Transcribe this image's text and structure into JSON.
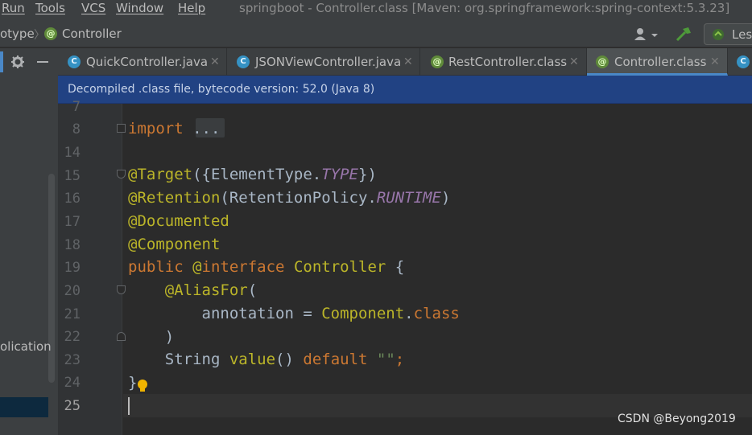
{
  "menubar": {
    "items": [
      "Run",
      "Tools",
      "VCS",
      "Window",
      "Help"
    ],
    "title": "springboot - Controller.class [Maven: org.springframework:spring-context:5.3.23]"
  },
  "navbar": {
    "crumb_prev": "otype",
    "crumb_current": "Controller",
    "run_config": "Les"
  },
  "tabs": [
    {
      "label": "QuickController.java",
      "icon": "class-icon"
    },
    {
      "label": "JSONViewController.java",
      "icon": "class-icon"
    },
    {
      "label": "RestController.class",
      "icon": "annotation-icon"
    },
    {
      "label": "Controller.class",
      "icon": "annotation-icon",
      "active": true
    },
    {
      "label": "",
      "icon": "class-icon"
    }
  ],
  "infobar": {
    "message": "Decompiled .class file, bytecode version: 52.0 (Java 8)"
  },
  "sidebar": {
    "partial_label": "olication"
  },
  "editor": {
    "line_numbers": [
      "7",
      "8",
      "14",
      "15",
      "16",
      "17",
      "18",
      "19",
      "20",
      "21",
      "22",
      "23",
      "24",
      "25"
    ],
    "lines": [
      "",
      "import ...",
      "",
      "@Target({ElementType.TYPE})",
      "@Retention(RetentionPolicy.RUNTIME)",
      "@Documented",
      "@Component",
      "public @interface Controller {",
      "    @AliasFor(",
      "        annotation = Component.class",
      "    )",
      "    String value() default \"\";",
      "}",
      ""
    ]
  },
  "watermark": "CSDN @Beyong2019"
}
